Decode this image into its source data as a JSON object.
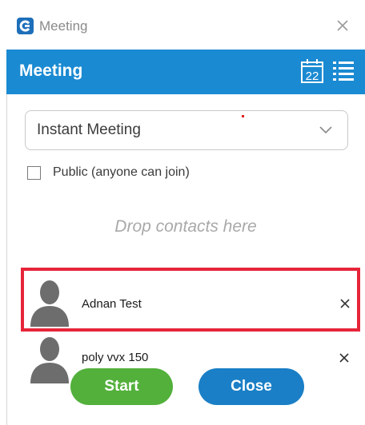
{
  "window": {
    "title": "Meeting"
  },
  "header": {
    "title": "Meeting",
    "calendar_day": "22"
  },
  "meeting_type": {
    "selected": "Instant Meeting"
  },
  "public_option": {
    "label": "Public (anyone can join)",
    "checked": false
  },
  "drop_hint": "Drop contacts here",
  "contacts": [
    {
      "name": "Adnan Test",
      "selected": true
    },
    {
      "name": "poly vvx 150",
      "selected": false
    }
  ],
  "buttons": {
    "start": "Start",
    "close": "Close"
  },
  "colors": {
    "header_bg": "#1a8ad2",
    "start_button": "#52b03b",
    "close_button": "#1a7fc6",
    "selection_border": "#e6253a"
  }
}
